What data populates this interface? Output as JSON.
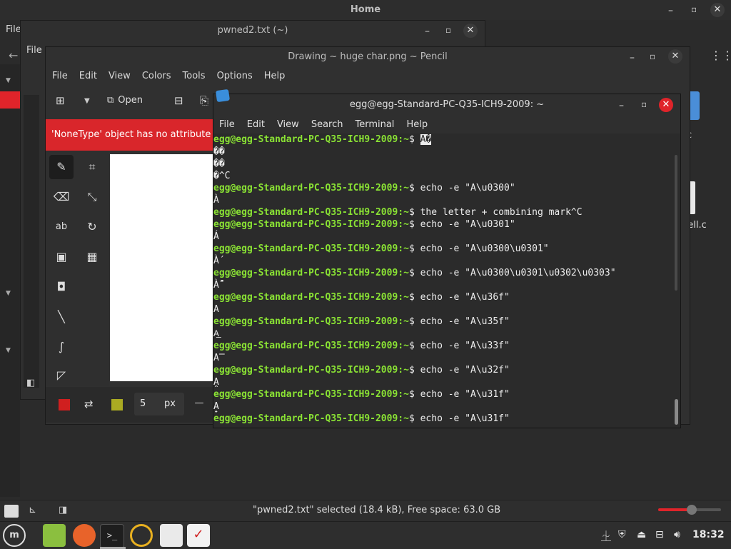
{
  "file_manager": {
    "title": "Home",
    "menu_file": "File",
    "status_text": "\"pwned2.txt\" selected (18.4 kB), Free space: 63.0 GB",
    "files": [
      "c",
      "nell.c"
    ]
  },
  "editor": {
    "title": "pwned2.txt (~)",
    "menu_file": "File"
  },
  "pencil": {
    "title": "Drawing ~ huge char.png ~ Pencil",
    "menu": [
      "File",
      "Edit",
      "View",
      "Colors",
      "Tools",
      "Options",
      "Help"
    ],
    "open_label": "Open",
    "error_text": "'NoneType' object has no attribute 're",
    "size_value": "5",
    "size_unit": "px",
    "primary_color": "#d01f1f",
    "secondary_color": "#aaaa22"
  },
  "terminal": {
    "title": "egg@egg-Standard-PC-Q35-ICH9-2009: ~",
    "menu": [
      "File",
      "Edit",
      "View",
      "Search",
      "Terminal",
      "Help"
    ],
    "prompt": "egg@egg-Standard-PC-Q35-ICH9-2009:~$ ",
    "lines": [
      {
        "kind": "prompt",
        "cmd": "A�"
      },
      {
        "kind": "out",
        "text": "��"
      },
      {
        "kind": "out",
        "text": "��"
      },
      {
        "kind": "out",
        "text": "�^C"
      },
      {
        "kind": "prompt",
        "cmd": "echo -e \"A\\u0300\""
      },
      {
        "kind": "out",
        "text": "À"
      },
      {
        "kind": "prompt",
        "cmd": "the letter + combining mark^C"
      },
      {
        "kind": "prompt",
        "cmd": "echo -e \"A\\u0301\""
      },
      {
        "kind": "out",
        "text": "Á"
      },
      {
        "kind": "prompt",
        "cmd": "echo -e \"A\\u0300\\u0301\""
      },
      {
        "kind": "out",
        "text": "À́"
      },
      {
        "kind": "prompt",
        "cmd": "echo -e \"A\\u0300\\u0301\\u0302\\u0303\""
      },
      {
        "kind": "out",
        "text": "À́̂̃"
      },
      {
        "kind": "prompt",
        "cmd": "echo -e \"A\\u36f\""
      },
      {
        "kind": "out",
        "text": "A"
      },
      {
        "kind": "prompt",
        "cmd": "echo -e \"A\\u35f\""
      },
      {
        "kind": "out",
        "text": "A͟"
      },
      {
        "kind": "prompt",
        "cmd": "echo -e \"A\\u33f\""
      },
      {
        "kind": "out",
        "text": "A̿"
      },
      {
        "kind": "prompt",
        "cmd": "echo -e \"A\\u32f\""
      },
      {
        "kind": "out",
        "text": "A̯"
      },
      {
        "kind": "prompt",
        "cmd": "echo -e \"A\\u31f\""
      },
      {
        "kind": "out",
        "text": "A̟"
      },
      {
        "kind": "prompt",
        "cmd": "echo -e \"A\\u31f\""
      }
    ]
  },
  "taskbar": {
    "clock": "18:32",
    "apps": [
      "mint-menu-icon",
      "files-icon",
      "firefox-icon",
      "terminal-icon",
      "sync-icon",
      "paint-icon",
      "todo-icon"
    ]
  }
}
